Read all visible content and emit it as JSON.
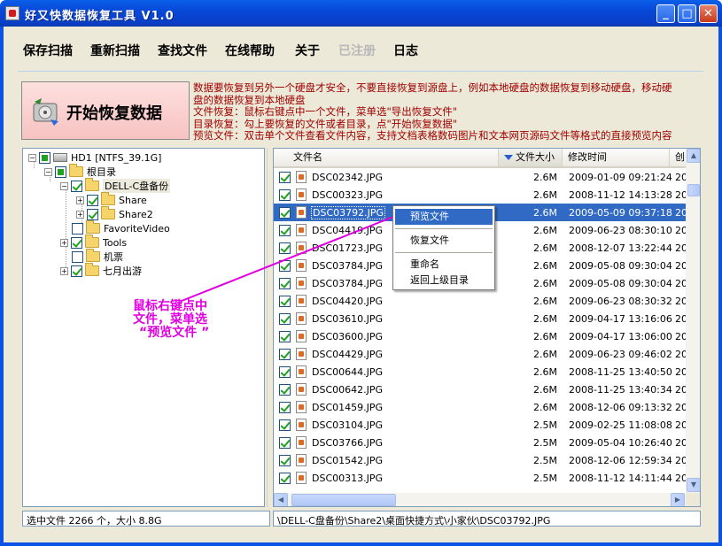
{
  "window": {
    "title": "好又快数据恢复工具 V1.0",
    "min_glyph": "_",
    "max_glyph": "□",
    "close_glyph": "✕"
  },
  "menu": {
    "items": [
      {
        "label": "保存扫描",
        "enabled": true
      },
      {
        "label": "重新扫描",
        "enabled": true
      },
      {
        "label": "查找文件",
        "enabled": true
      },
      {
        "label": "在线帮助",
        "enabled": true
      },
      {
        "label": "关于",
        "enabled": true
      },
      {
        "label": "已注册",
        "enabled": false
      },
      {
        "label": "日志",
        "enabled": true
      }
    ]
  },
  "start_button": {
    "label": "开始恢复数据",
    "icon": "disk-recover-icon"
  },
  "info_text": [
    "数据要恢复到另外一个硬盘才安全，不要直接恢复到源盘上，例如本地硬盘的数据恢复到移动硬盘，移动硬",
    "盘的数据恢复到本地硬盘",
    "文件恢复：鼠标右键点中一个文件，菜单选\"导出恢复文件\"",
    "目录恢复：勾上要恢复的文件或者目录，点\"开始恢复数据\"",
    "预览文件：双击单个文件查看文件内容，支持文档表格数码图片和文本网页源码文件等格式的直接预览内容"
  ],
  "tree": {
    "drive": "HD1 [NTFS_39.1G]",
    "root": "根目录",
    "backup": "DELL-C盘备份",
    "share": "Share",
    "share2": "Share2",
    "favorite_video": "FavoriteVideo",
    "tools": "Tools",
    "jipiao": "机票",
    "qiyue": "七月出游"
  },
  "list": {
    "columns": {
      "name": "文件名",
      "size": "文件大小",
      "mtime": "修改时间",
      "ctime": "创"
    },
    "rows": [
      {
        "name": "DSC02342.JPG",
        "size": "2.6M",
        "mtime": "2009-01-09 09:21:24",
        "ctime": "20"
      },
      {
        "name": "DSC00323.JPG",
        "size": "2.6M",
        "mtime": "2008-11-12 14:13:28",
        "ctime": "20"
      },
      {
        "name": "DSC03792.JPG",
        "size": "2.6M",
        "mtime": "2009-05-09 09:37:18",
        "ctime": "20"
      },
      {
        "name": "DSC04419.JPG",
        "size": "2.6M",
        "mtime": "2009-06-23 08:30:10",
        "ctime": "20"
      },
      {
        "name": "DSC01723.JPG",
        "size": "2.6M",
        "mtime": "2008-12-07 13:22:44",
        "ctime": "20"
      },
      {
        "name": "DSC03784.JPG",
        "size": "2.6M",
        "mtime": "2009-05-08 09:30:04",
        "ctime": "20"
      },
      {
        "name": "DSC03784.JPG",
        "size": "2.6M",
        "mtime": "2009-05-08 09:30:04",
        "ctime": "20"
      },
      {
        "name": "DSC04420.JPG",
        "size": "2.6M",
        "mtime": "2009-06-23 08:30:32",
        "ctime": "20"
      },
      {
        "name": "DSC03610.JPG",
        "size": "2.6M",
        "mtime": "2009-04-17 13:16:06",
        "ctime": "20"
      },
      {
        "name": "DSC03600.JPG",
        "size": "2.6M",
        "mtime": "2009-04-17 13:06:00",
        "ctime": "20"
      },
      {
        "name": "DSC04429.JPG",
        "size": "2.6M",
        "mtime": "2009-06-23 09:46:02",
        "ctime": "20"
      },
      {
        "name": "DSC00644.JPG",
        "size": "2.6M",
        "mtime": "2008-11-25 13:40:50",
        "ctime": "20"
      },
      {
        "name": "DSC00642.JPG",
        "size": "2.6M",
        "mtime": "2008-11-25 13:40:34",
        "ctime": "20"
      },
      {
        "name": "DSC01459.JPG",
        "size": "2.6M",
        "mtime": "2008-12-06 09:13:32",
        "ctime": "20"
      },
      {
        "name": "DSC03104.JPG",
        "size": "2.5M",
        "mtime": "2009-02-25 11:08:08",
        "ctime": "20"
      },
      {
        "name": "DSC03766.JPG",
        "size": "2.5M",
        "mtime": "2009-05-04 10:26:40",
        "ctime": "20"
      },
      {
        "name": "DSC01542.JPG",
        "size": "2.5M",
        "mtime": "2008-12-06 12:59:34",
        "ctime": "20"
      },
      {
        "name": "DSC00313.JPG",
        "size": "2.5M",
        "mtime": "2008-11-12 14:11:44",
        "ctime": "20"
      }
    ],
    "selected_index": 2
  },
  "context_menu": {
    "items": [
      "预览文件",
      "恢复文件",
      "重命名",
      "返回上级目录"
    ]
  },
  "annotation": {
    "lines": [
      "鼠标右键点中",
      "文件，菜单选",
      "“预览文件 ”"
    ]
  },
  "status": {
    "left": "选中文件 2266 个，大小 8.8G",
    "right": "\\DELL-C盘备份\\Share2\\桌面快捷方式\\小家伙\\DSC03792.JPG"
  },
  "colors": {
    "titlebar": "#0a53e4",
    "info_text": "#a00000",
    "annotation": "#e000e0",
    "selection": "#316ac5"
  }
}
